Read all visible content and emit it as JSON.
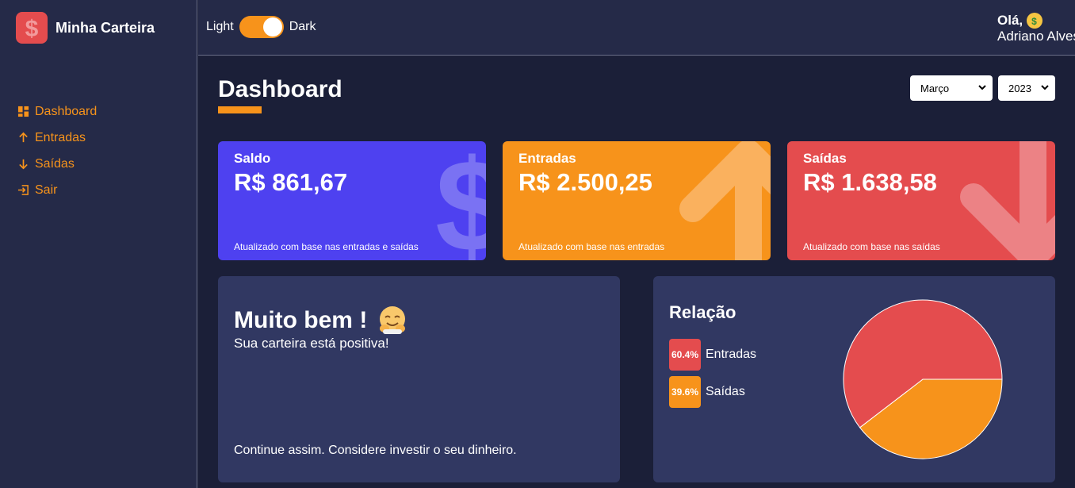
{
  "brand": {
    "name": "Minha Carteira",
    "logo_icon": "dollar-icon"
  },
  "sidebar": {
    "items": [
      {
        "label": "Dashboard",
        "icon": "dashboard-icon"
      },
      {
        "label": "Entradas",
        "icon": "arrow-up-icon"
      },
      {
        "label": "Saídas",
        "icon": "arrow-down-icon"
      },
      {
        "label": "Sair",
        "icon": "exit-icon"
      }
    ]
  },
  "header": {
    "theme_light": "Light",
    "theme_dark": "Dark",
    "greeting": "Olá,",
    "user_name": "Adriano Alves"
  },
  "page": {
    "title": "Dashboard",
    "month_select": "Março",
    "year_select": "2023"
  },
  "cards": [
    {
      "label": "Saldo",
      "amount": "R$ 861,67",
      "note": "Atualizado com base nas entradas e saídas",
      "color": "#4e41f0"
    },
    {
      "label": "Entradas",
      "amount": "R$ 2.500,25",
      "note": "Atualizado com base nas entradas",
      "color": "#f7931b"
    },
    {
      "label": "Saídas",
      "amount": "R$ 1.638,58",
      "note": "Atualizado com base nas saídas",
      "color": "#e44c4e"
    }
  ],
  "message": {
    "title": "Muito bem !",
    "subtitle": "Sua carteira está positiva!",
    "footer": "Continue assim. Considere investir o seu dinheiro."
  },
  "relation": {
    "title": "Relação",
    "legend": [
      {
        "percent": "60.4%",
        "label": "Entradas",
        "color": "#e44c4e"
      },
      {
        "percent": "39.6%",
        "label": "Saídas",
        "color": "#f7931b"
      }
    ]
  },
  "chart_data": {
    "type": "pie",
    "title": "Relação",
    "slices": [
      {
        "name": "Entradas",
        "value": 60.4,
        "color": "#e44c4e"
      },
      {
        "name": "Saídas",
        "value": 39.6,
        "color": "#f7931b"
      }
    ]
  }
}
